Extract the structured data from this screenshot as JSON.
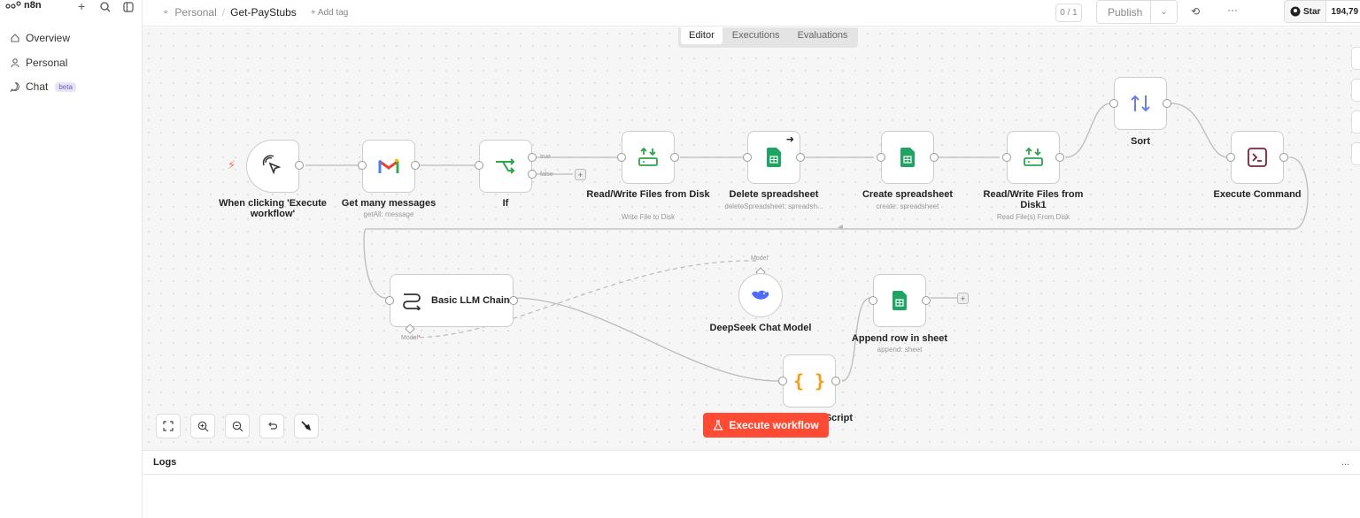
{
  "app": {
    "name": "n8n"
  },
  "sidebar": {
    "items": [
      {
        "label": "Overview",
        "icon": "home-icon"
      },
      {
        "label": "Personal",
        "icon": "user-icon"
      },
      {
        "label": "Chat",
        "icon": "chat-icon",
        "badge": "beta"
      }
    ]
  },
  "header": {
    "project": "Personal",
    "workflow_name": "Get-PayStubs",
    "add_tag": "+ Add tag",
    "counter": "0 / 1",
    "publish_label": "Publish",
    "github_star_label": "Star",
    "github_star_count": "194,79"
  },
  "canvas": {
    "tabs": [
      "Editor",
      "Executions",
      "Evaluations"
    ],
    "active_tab": "Editor",
    "execute_label": "Execute workflow",
    "nodes": [
      {
        "id": "trigger",
        "label": "When clicking 'Execute workflow'"
      },
      {
        "id": "gmail",
        "label": "Get many messages",
        "sub": "getAll: message"
      },
      {
        "id": "if",
        "label": "If"
      },
      {
        "id": "rw1",
        "label": "Read/Write Files from Disk",
        "sub": "Write File to Disk"
      },
      {
        "id": "del",
        "label": "Delete spreadsheet",
        "sub": "deleteSpreadsheet: spreadsh..."
      },
      {
        "id": "create",
        "label": "Create spreadsheet",
        "sub": "create: spreadsheet"
      },
      {
        "id": "rw2",
        "label": "Read/Write Files from Disk1",
        "sub": "Read File(s) From Disk"
      },
      {
        "id": "sort",
        "label": "Sort"
      },
      {
        "id": "exec",
        "label": "Execute Command"
      },
      {
        "id": "llm",
        "label": "Basic LLM Chain"
      },
      {
        "id": "deepseek",
        "label": "DeepSeek Chat Model"
      },
      {
        "id": "append",
        "label": "Append row in sheet",
        "sub": "append: sheet"
      },
      {
        "id": "code",
        "label": "Script"
      }
    ],
    "if_true": "true",
    "if_false": "false",
    "model_label_top": "Model",
    "model_label_bottom": "Model"
  },
  "logs": {
    "title": "Logs",
    "more": "..."
  }
}
